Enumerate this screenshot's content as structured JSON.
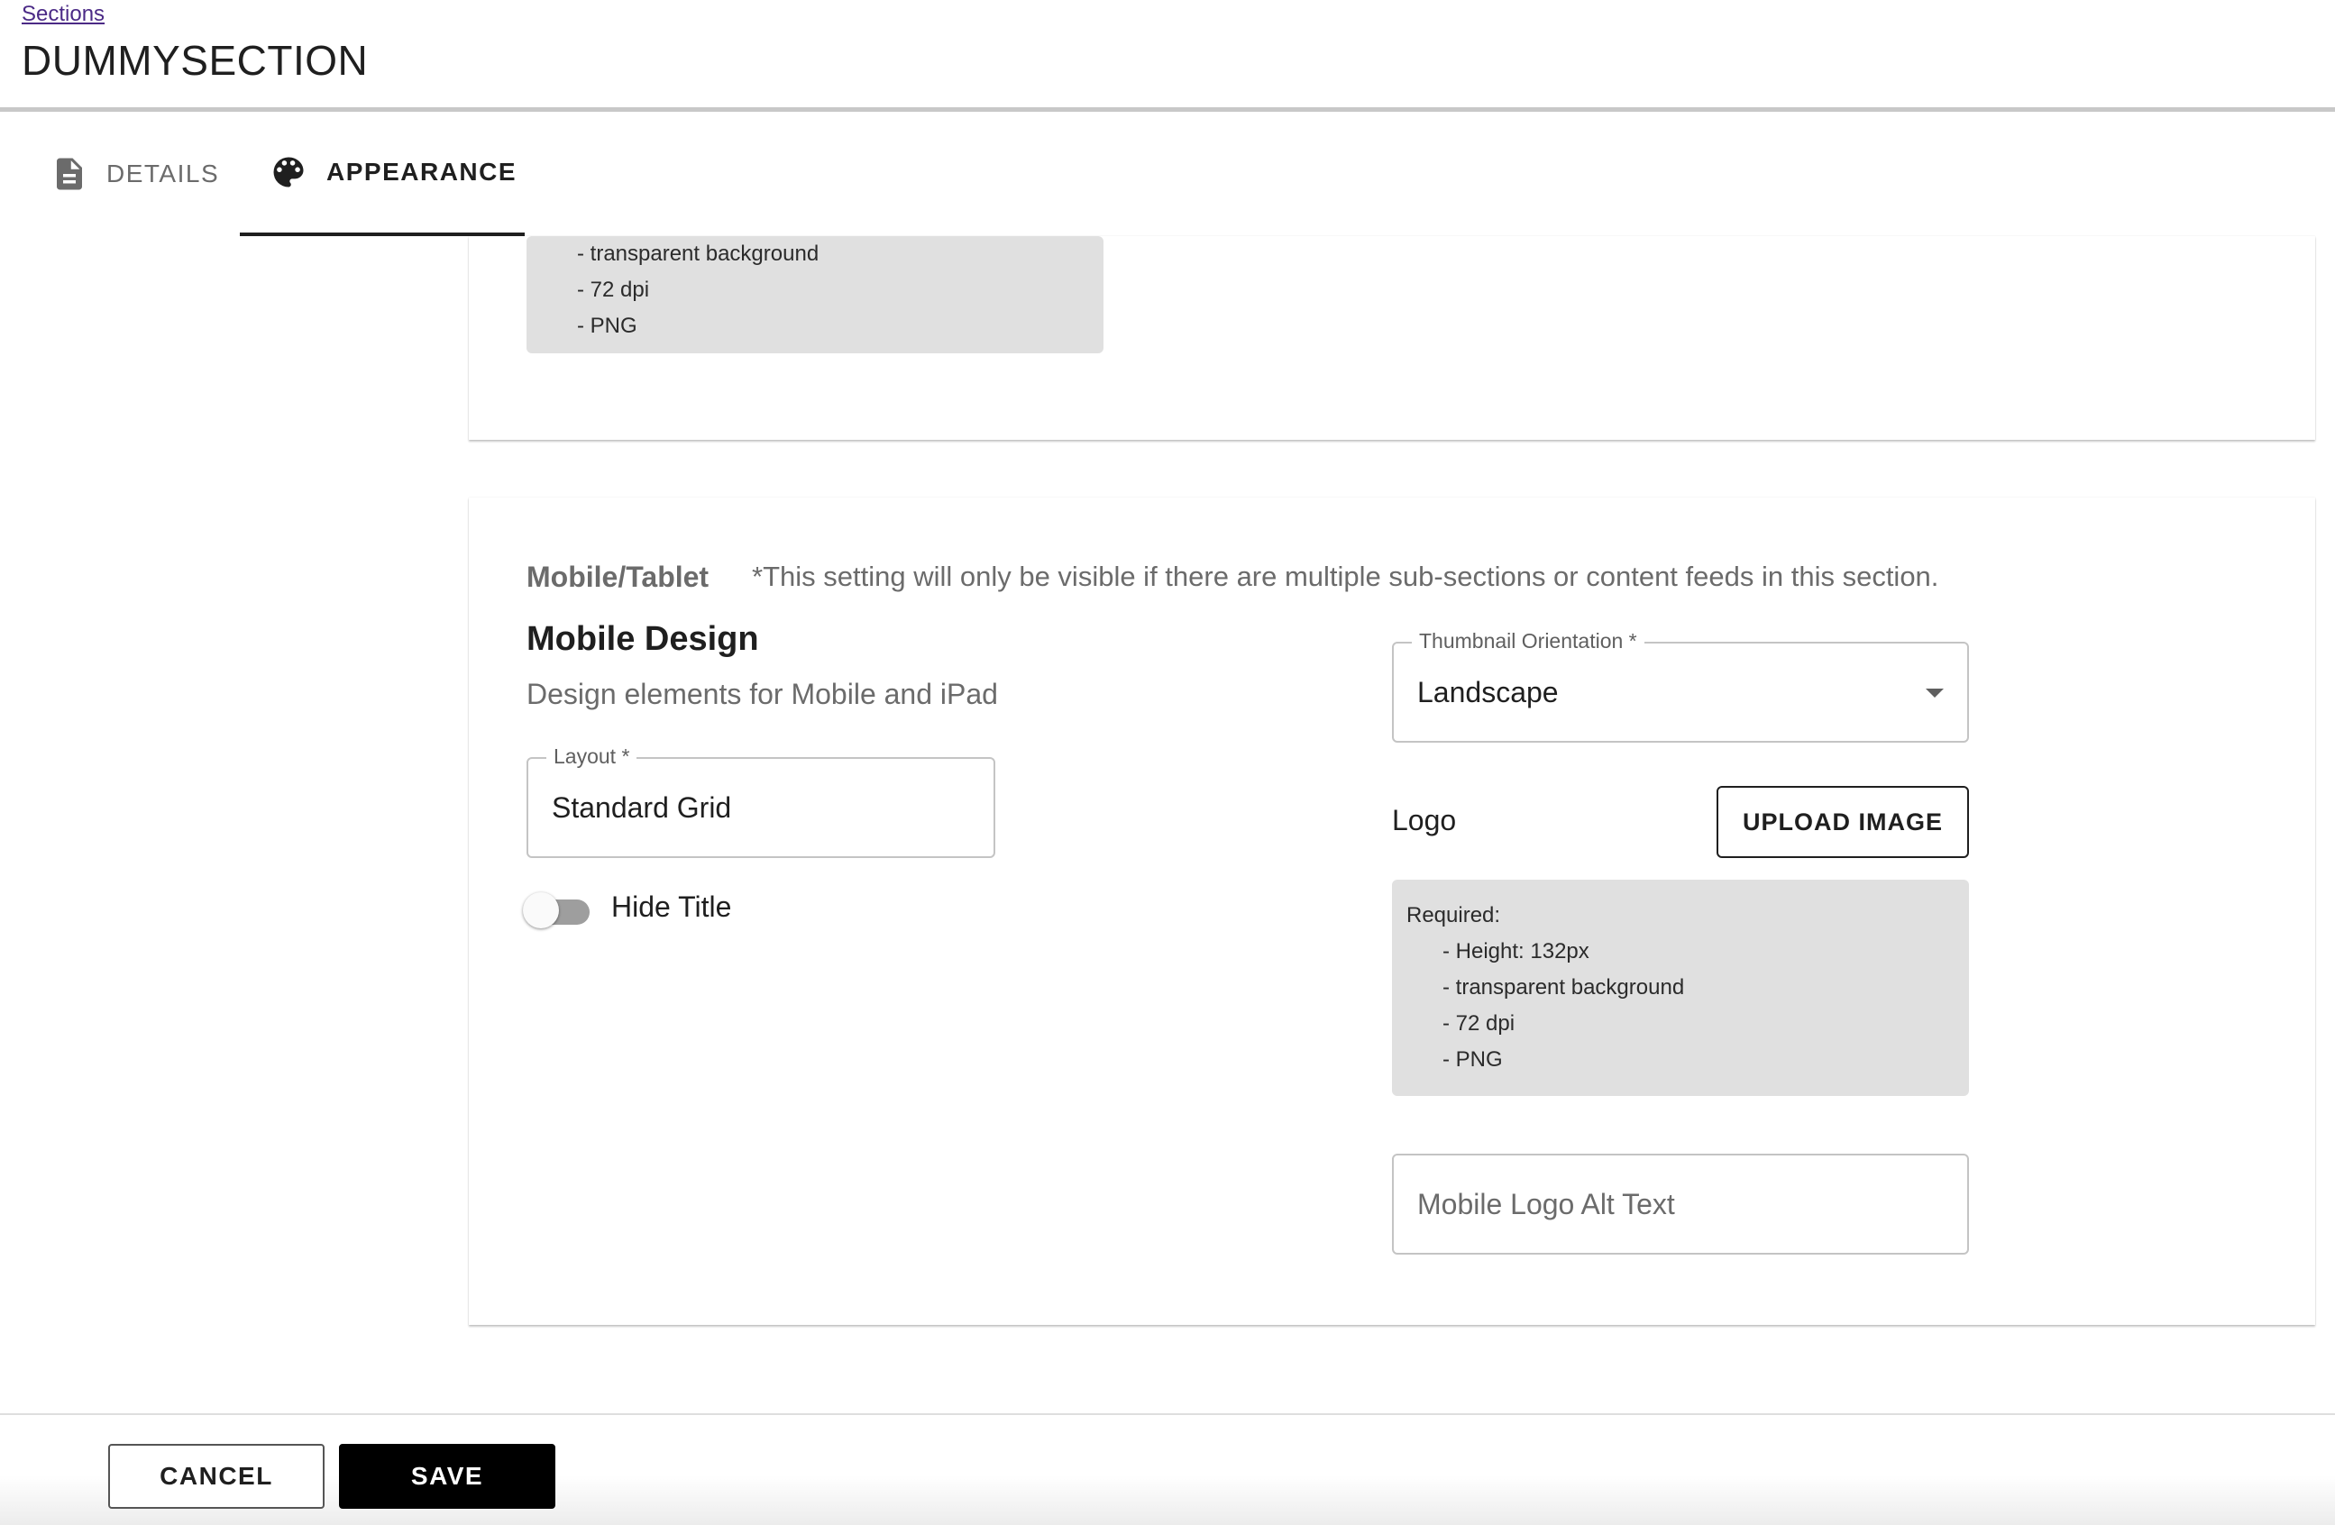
{
  "breadcrumb": "Sections",
  "page_title": "DUMMYSECTION",
  "tabs": [
    {
      "label": "DETAILS",
      "icon": "document-icon",
      "active": false
    },
    {
      "label": "APPEARANCE",
      "icon": "palette-icon",
      "active": true
    }
  ],
  "top_card": {
    "requirements": [
      "- transparent background",
      "- 72 dpi",
      "- PNG"
    ]
  },
  "mobile_card": {
    "section_label": "Mobile/Tablet",
    "section_note": "*This setting will only be visible if there are multiple sub-sections or content feeds in this section.",
    "heading": "Mobile Design",
    "subheading": "Design elements for Mobile and iPad",
    "layout_field": {
      "legend": "Layout *",
      "value": "Standard Grid"
    },
    "hide_title_toggle": {
      "label": "Hide Title",
      "checked": false
    },
    "thumbnail_orientation": {
      "legend": "Thumbnail Orientation *",
      "value": "Landscape"
    },
    "logo": {
      "label": "Logo",
      "upload_label": "UPLOAD IMAGE",
      "requirements_title": "Required:",
      "requirements": [
        "- Height: 132px",
        "- transparent background",
        "- 72 dpi",
        "- PNG"
      ]
    },
    "alt_text_field": {
      "placeholder": "Mobile Logo Alt Text"
    }
  },
  "footer": {
    "cancel_label": "CANCEL",
    "save_label": "SAVE"
  },
  "colors": {
    "breadcrumb_link": "#4b2a86",
    "primary_button": "#000000",
    "requirements_bg": "#e0e0e0"
  }
}
